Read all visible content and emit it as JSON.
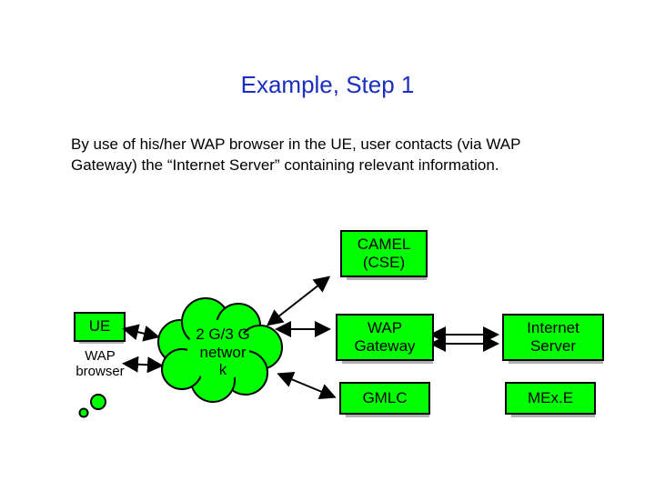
{
  "title": "Example, Step 1",
  "body": "By use of his/her WAP browser in the UE, user contacts (via WAP Gateway) the “Internet Server” containing relevant information.",
  "nodes": {
    "camel": "CAMEL (CSE)",
    "ue": "UE",
    "wap_browser_1": "WAP",
    "wap_browser_2": "browser",
    "cloud_1": "2 G/3 G",
    "cloud_2": "networ",
    "cloud_3": "k",
    "wap_gw_1": "WAP",
    "wap_gw_2": "Gateway",
    "gmlc": "GMLC",
    "inet_1": "Internet",
    "inet_2": "Server",
    "mexe": "MEx.E"
  }
}
